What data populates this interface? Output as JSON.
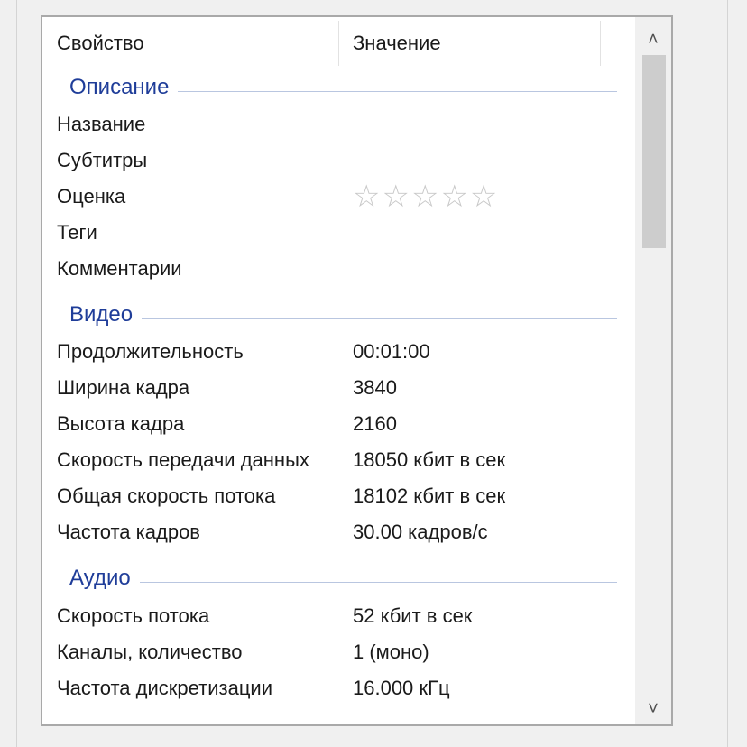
{
  "columns": {
    "property": "Свойство",
    "value": "Значение"
  },
  "groups": {
    "description": "Описание",
    "video": "Видео",
    "audio": "Аудио"
  },
  "description_rows": [
    {
      "label": "Название",
      "value": ""
    },
    {
      "label": "Субтитры",
      "value": ""
    },
    {
      "label": "Оценка",
      "stars": "☆☆☆☆☆",
      "rating": 0,
      "rating_max": 5
    },
    {
      "label": "Теги",
      "value": ""
    },
    {
      "label": "Комментарии",
      "value": ""
    }
  ],
  "video_rows": [
    {
      "label": "Продолжительность",
      "value": "00:01:00"
    },
    {
      "label": "Ширина кадра",
      "value": "3840"
    },
    {
      "label": "Высота кадра",
      "value": "2160"
    },
    {
      "label": "Скорость передачи данных",
      "value": "18050 кбит в сек"
    },
    {
      "label": "Общая скорость потока",
      "value": "18102 кбит в сек"
    },
    {
      "label": "Частота кадров",
      "value": "30.00 кадров/с"
    }
  ],
  "audio_rows": [
    {
      "label": "Скорость потока",
      "value": "52 кбит в сек"
    },
    {
      "label": "Каналы, количество",
      "value": "1 (моно)"
    },
    {
      "label": "Частота дискретизации",
      "value": "16.000 кГц"
    }
  ],
  "scrollbar": {
    "up_glyph": "˄",
    "down_glyph": "˅"
  }
}
